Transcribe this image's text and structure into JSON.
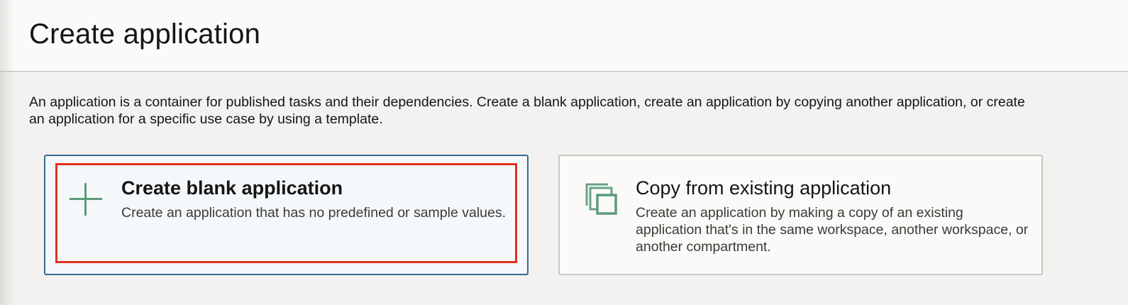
{
  "page": {
    "title": "Create application",
    "description": "An application is a container for published tasks and their dependencies. Create a blank application, create an application by copying another application, or create an application for a specific use case by using a template."
  },
  "options": {
    "blank": {
      "icon": "plus-icon",
      "title": "Create blank application",
      "description": "Create an application that has no predefined or sample values.",
      "selected": true
    },
    "copy": {
      "icon": "copy-icon",
      "title": "Copy from existing application",
      "description": "Create an application by making a copy of an existing application that's in the same workspace, another workspace, or another compartment.",
      "selected": false
    }
  },
  "colors": {
    "selected_border": "#3a6a8b",
    "highlight_annotation": "#e0301e",
    "icon_green": "#5b9c78"
  }
}
